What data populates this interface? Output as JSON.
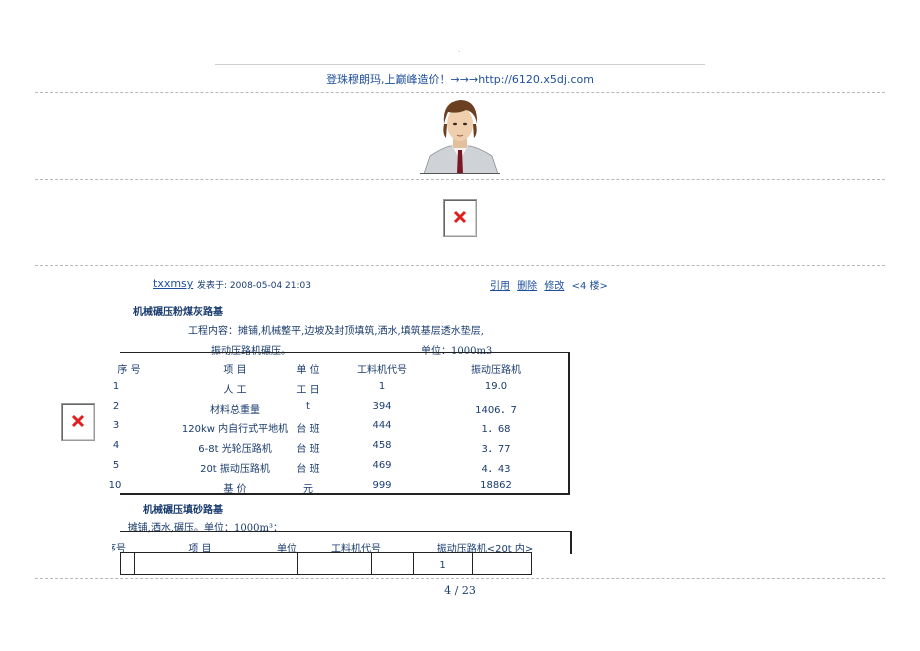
{
  "header": {
    "dot": ".",
    "login_text": "登珠穆朗玛,上巅峰造价！→→→http://6120.x5dj.com"
  },
  "post": {
    "username": "txxmsy",
    "posted_at": "发表于: 2008-05-04 21:03",
    "actions": [
      "引用",
      "删除",
      "修改"
    ],
    "floor": "<4 楼>"
  },
  "section1": {
    "title": "机械碾压粉煤灰路基",
    "content": "工程内容：摊铺,机械整平,边坡及封顶填筑,洒水,填筑基层透水垫层,",
    "content2": "振动压路机碾压。",
    "unit": "单位：1000m3",
    "headers": [
      "序 号",
      "项 目",
      "单 位",
      "工料机代号",
      "振动压路机"
    ],
    "rows": [
      {
        "no": "1",
        "item": "人 工",
        "unit": "工 日",
        "code": "1",
        "value": "19.0"
      },
      {
        "no": "2",
        "item": "材料总重量",
        "unit": "t",
        "code": "394",
        "value": "1406．7"
      },
      {
        "no": "3",
        "item": "120kw 内自行式平地机",
        "unit": "台 班",
        "code": "444",
        "value": "1．68"
      },
      {
        "no": "4",
        "item": "6-8t 光轮压路机",
        "unit": "台 班",
        "code": "458",
        "value": "3．77"
      },
      {
        "no": "5",
        "item": "20t 振动压路机",
        "unit": "台 班",
        "code": "469",
        "value": "4．43"
      },
      {
        "no": "10",
        "item": "基 价",
        "unit": "元",
        "code": "999",
        "value": "18862"
      }
    ]
  },
  "section2": {
    "title": "机械碾压填砂路基",
    "content": "：摊铺,洒水,碾压。单位：1000m³",
    "headers": [
      "序号",
      "项 目",
      "单位",
      "工料机代号",
      "振动压路机<20t 内>"
    ],
    "row1_value": "1"
  },
  "footer": {
    "page": "4 / 23"
  }
}
